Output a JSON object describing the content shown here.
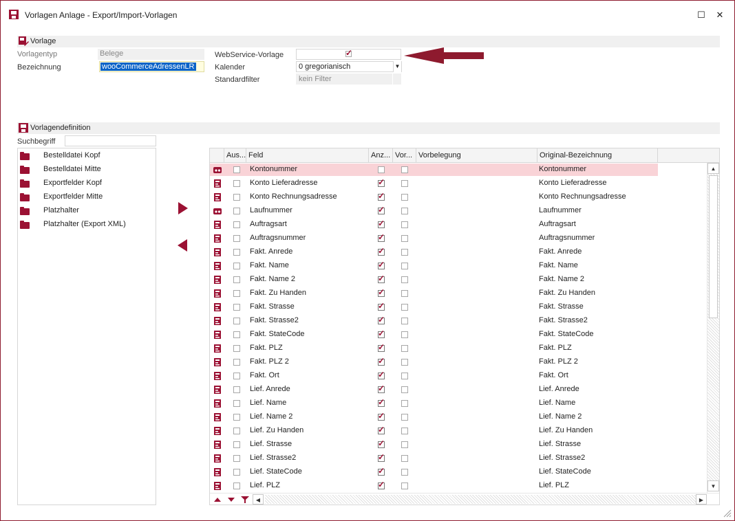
{
  "window": {
    "title": "Vorlagen Anlage - Export/Import-Vorlagen",
    "maximize_glyph": "☐",
    "close_glyph": "✕"
  },
  "vorlage": {
    "section_title": "Vorlage",
    "vorlagentyp_label": "Vorlagentyp",
    "vorlagentyp_value": "Belege",
    "bezeichnung_label": "Bezeichnung",
    "bezeichnung_value": "wooCommerceAdressenLR",
    "webservice_label": "WebService-Vorlage",
    "webservice_checked": true,
    "kalender_label": "Kalender",
    "kalender_value": "0 gregorianisch",
    "standardfilter_label": "Standardfilter",
    "standardfilter_value": "kein Filter"
  },
  "annotation": {
    "arrow_color": "#8e1a2e"
  },
  "definition": {
    "section_title": "Vorlagendefinition",
    "search_label": "Suchbegriff",
    "search_value": "",
    "folders": [
      {
        "label": "Bestelldatei Kopf"
      },
      {
        "label": "Bestelldatei Mitte"
      },
      {
        "label": "Exportfelder Kopf"
      },
      {
        "label": "Exportfelder Mitte"
      },
      {
        "label": "Platzhalter"
      },
      {
        "label": "Platzhalter (Export XML)"
      }
    ]
  },
  "grid": {
    "columns": [
      "Aus...",
      "Feld",
      "Anz...",
      "Vor...",
      "Vorbelegung",
      "Original-Bezeichnung"
    ],
    "rows": [
      {
        "icon": "key-field-icon",
        "aus": false,
        "feld": "Kontonummer",
        "anz": false,
        "vor": false,
        "vorbelegung": "",
        "original": "Kontonummer",
        "selected": true
      },
      {
        "icon": "field-icon",
        "aus": false,
        "feld": "Konto Lieferadresse",
        "anz": true,
        "vor": false,
        "vorbelegung": "",
        "original": "Konto Lieferadresse"
      },
      {
        "icon": "field-icon",
        "aus": false,
        "feld": "Konto Rechnungsadresse",
        "anz": true,
        "vor": false,
        "vorbelegung": "",
        "original": "Konto Rechnungsadresse"
      },
      {
        "icon": "key-field-icon",
        "aus": false,
        "feld": "Laufnummer",
        "anz": true,
        "vor": false,
        "vorbelegung": "",
        "original": "Laufnummer"
      },
      {
        "icon": "field-icon",
        "aus": false,
        "feld": "Auftragsart",
        "anz": true,
        "vor": false,
        "vorbelegung": "",
        "original": "Auftragsart"
      },
      {
        "icon": "field-icon",
        "aus": false,
        "feld": "Auftragsnummer",
        "anz": true,
        "vor": false,
        "vorbelegung": "",
        "original": "Auftragsnummer"
      },
      {
        "icon": "field-icon",
        "aus": false,
        "feld": "Fakt. Anrede",
        "anz": true,
        "vor": false,
        "vorbelegung": "",
        "original": "Fakt. Anrede"
      },
      {
        "icon": "field-icon",
        "aus": false,
        "feld": "Fakt. Name",
        "anz": true,
        "vor": false,
        "vorbelegung": "",
        "original": "Fakt. Name"
      },
      {
        "icon": "field-icon",
        "aus": false,
        "feld": "Fakt. Name 2",
        "anz": true,
        "vor": false,
        "vorbelegung": "",
        "original": "Fakt. Name 2"
      },
      {
        "icon": "field-icon",
        "aus": false,
        "feld": "Fakt. Zu Handen",
        "anz": true,
        "vor": false,
        "vorbelegung": "",
        "original": "Fakt. Zu Handen"
      },
      {
        "icon": "field-icon",
        "aus": false,
        "feld": "Fakt. Strasse",
        "anz": true,
        "vor": false,
        "vorbelegung": "",
        "original": "Fakt. Strasse"
      },
      {
        "icon": "field-icon",
        "aus": false,
        "feld": "Fakt. Strasse2",
        "anz": true,
        "vor": false,
        "vorbelegung": "",
        "original": "Fakt. Strasse2"
      },
      {
        "icon": "field-icon",
        "aus": false,
        "feld": "Fakt. StateCode",
        "anz": true,
        "vor": false,
        "vorbelegung": "",
        "original": "Fakt. StateCode"
      },
      {
        "icon": "field-icon",
        "aus": false,
        "feld": "Fakt. PLZ",
        "anz": true,
        "vor": false,
        "vorbelegung": "",
        "original": "Fakt. PLZ"
      },
      {
        "icon": "field-icon",
        "aus": false,
        "feld": "Fakt. PLZ 2",
        "anz": true,
        "vor": false,
        "vorbelegung": "",
        "original": "Fakt. PLZ 2"
      },
      {
        "icon": "field-icon",
        "aus": false,
        "feld": "Fakt. Ort",
        "anz": true,
        "vor": false,
        "vorbelegung": "",
        "original": "Fakt. Ort"
      },
      {
        "icon": "field-icon",
        "aus": false,
        "feld": "Lief. Anrede",
        "anz": true,
        "vor": false,
        "vorbelegung": "",
        "original": "Lief. Anrede"
      },
      {
        "icon": "field-icon",
        "aus": false,
        "feld": "Lief. Name",
        "anz": true,
        "vor": false,
        "vorbelegung": "",
        "original": "Lief. Name"
      },
      {
        "icon": "field-icon",
        "aus": false,
        "feld": "Lief. Name 2",
        "anz": true,
        "vor": false,
        "vorbelegung": "",
        "original": "Lief. Name 2"
      },
      {
        "icon": "field-icon",
        "aus": false,
        "feld": "Lief. Zu Handen",
        "anz": true,
        "vor": false,
        "vorbelegung": "",
        "original": "Lief. Zu Handen"
      },
      {
        "icon": "field-icon",
        "aus": false,
        "feld": "Lief. Strasse",
        "anz": true,
        "vor": false,
        "vorbelegung": "",
        "original": "Lief. Strasse"
      },
      {
        "icon": "field-icon",
        "aus": false,
        "feld": "Lief. Strasse2",
        "anz": true,
        "vor": false,
        "vorbelegung": "",
        "original": "Lief. Strasse2"
      },
      {
        "icon": "field-icon",
        "aus": false,
        "feld": "Lief. StateCode",
        "anz": true,
        "vor": false,
        "vorbelegung": "",
        "original": "Lief. StateCode"
      },
      {
        "icon": "field-icon",
        "aus": false,
        "feld": "Lief. PLZ",
        "anz": true,
        "vor": false,
        "vorbelegung": "",
        "original": "Lief. PLZ"
      }
    ]
  },
  "colors": {
    "accent": "#9b1133",
    "selected_row": "#f9d3d7",
    "selection_text_bg": "#0a63c8"
  }
}
